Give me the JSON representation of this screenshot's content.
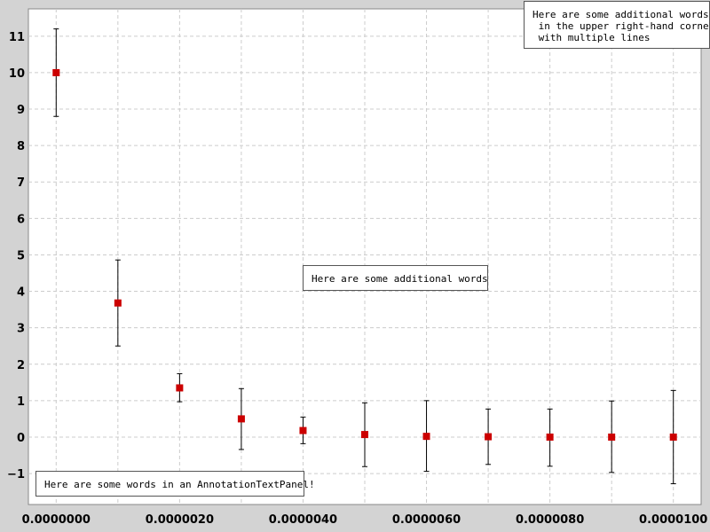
{
  "chart_data": {
    "type": "scatter",
    "x": [
      0.0,
      1e-06,
      2e-06,
      3e-06,
      4e-06,
      5e-06,
      6e-06,
      7e-06,
      8e-06,
      9e-06,
      1e-05
    ],
    "y": [
      10.0,
      3.68,
      1.35,
      0.5,
      0.18,
      0.07,
      0.02,
      0.01,
      0.0,
      0.0,
      0.0
    ],
    "error_low": [
      8.8,
      2.5,
      0.97,
      -0.34,
      -0.18,
      -0.81,
      -0.94,
      -0.75,
      -0.8,
      -0.97,
      -1.28
    ],
    "error_high": [
      11.2,
      4.86,
      1.74,
      1.33,
      0.55,
      0.94,
      1.0,
      0.77,
      0.77,
      0.99,
      1.28
    ],
    "xlim": [
      -4.5e-07,
      1.045e-05
    ],
    "ylim": [
      -1.85,
      11.75
    ],
    "xticks": [
      0.0,
      2e-06,
      4e-06,
      6e-06,
      8e-06,
      1e-05
    ],
    "xtick_labels": [
      "0.0000000",
      "0.0000020",
      "0.0000040",
      "0.0000060",
      "0.0000080",
      "0.0000100"
    ],
    "yticks": [
      -1,
      0,
      1,
      2,
      3,
      4,
      5,
      6,
      7,
      8,
      9,
      10,
      11
    ],
    "ytick_labels": [
      "−1",
      "0",
      "1",
      "2",
      "3",
      "4",
      "5",
      "6",
      "7",
      "8",
      "9",
      "10",
      "11"
    ],
    "grid": true,
    "marker": "square",
    "colors": {
      "marker": "#cc0000",
      "errorbar": "#000000",
      "grid": "#cccccc",
      "plot_bg": "#ffffff",
      "outer_bg": "#d3d3d3"
    },
    "title": "",
    "xlabel": "",
    "ylabel": ""
  },
  "annotations": {
    "bottom_left": "Here are some words in an AnnotationTextPanel!",
    "center": "Here are some additional words",
    "top_right": "Here are some additional words\n in the upper right-hand corner\n with multiple lines"
  }
}
